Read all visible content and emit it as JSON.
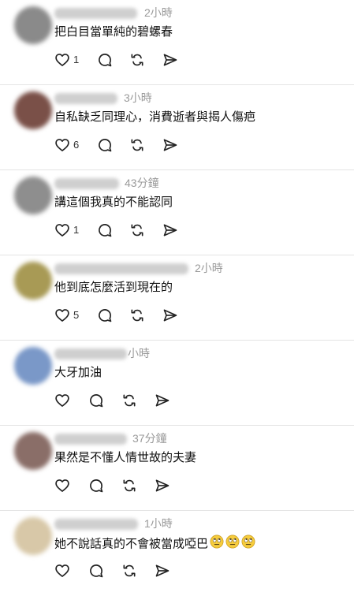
{
  "comments": [
    {
      "time": "2小時",
      "text": "把白目當單純的碧螺春",
      "likes": "1",
      "avatar_color": "#8a8a8a"
    },
    {
      "time": "3小時",
      "text": "自私缺乏同理心，消費逝者與揭人傷疤",
      "likes": "6",
      "avatar_color": "#7a5048"
    },
    {
      "time": "43分鐘",
      "text": "講這個我真的不能認同",
      "likes": "1",
      "avatar_color": "#8e8e8e"
    },
    {
      "time": "2小時",
      "text": "他到底怎麼活到現在的",
      "likes": "5",
      "avatar_color": "#a89a55"
    },
    {
      "time": "小時",
      "text": "大牙加油",
      "likes": "",
      "avatar_color": "#7a98c8"
    },
    {
      "time": "37分鐘",
      "text": "果然是不懂人情世故的夫妻",
      "likes": "",
      "avatar_color": "#8a6e68"
    },
    {
      "time": "1小時",
      "text": "她不說話真的不會被當成啞巴",
      "likes": "",
      "avatar_color": "#d8c8a8",
      "emojis": [
        "eye-roll-emoji",
        "eye-roll-emoji",
        "eye-roll-emoji"
      ]
    }
  ],
  "icons": {
    "like": "heart-icon",
    "reply": "comment-bubble-icon",
    "repost": "repost-icon",
    "share": "send-icon"
  },
  "colors": {
    "timestamp": "#9a9a9a",
    "text": "#111111",
    "divider": "#e4e4e4",
    "icon_stroke": "#222222"
  }
}
